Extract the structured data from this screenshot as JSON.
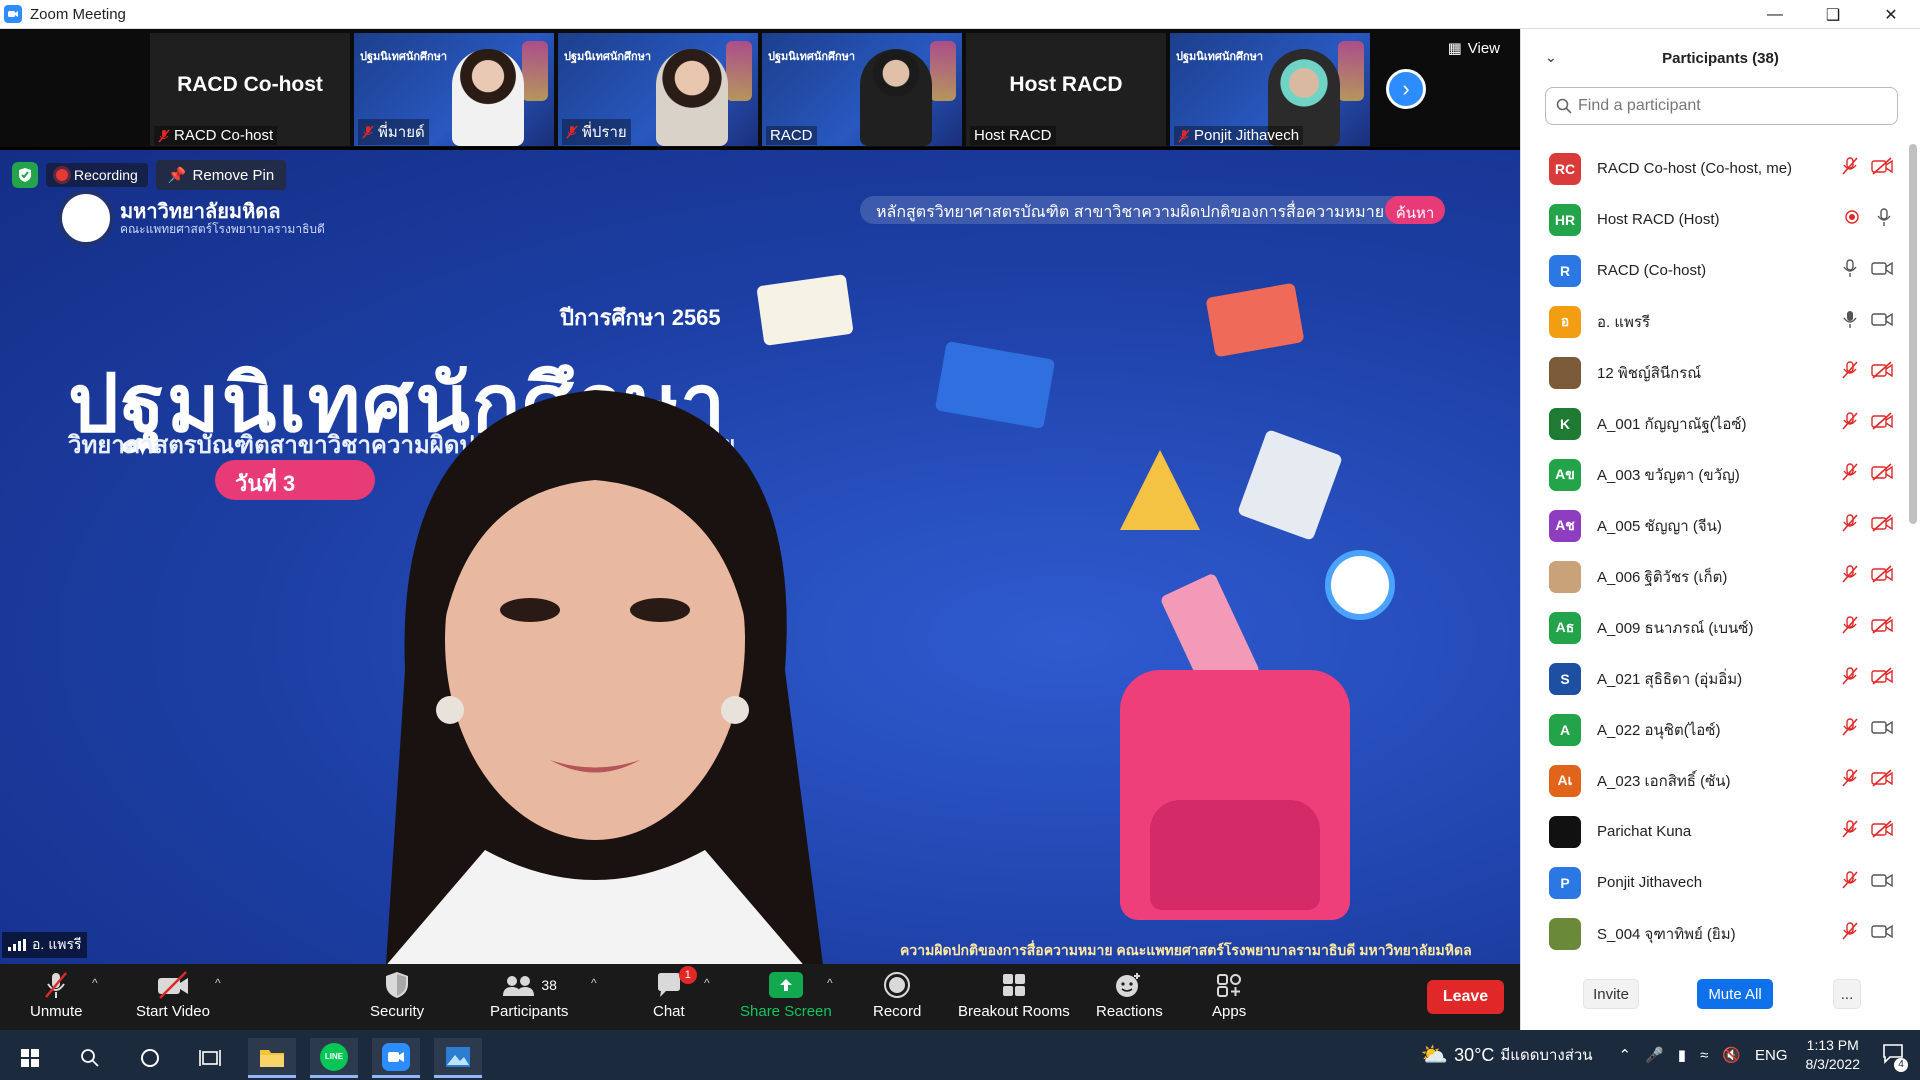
{
  "window": {
    "title": "Zoom Meeting",
    "controls": [
      "minimize",
      "restore",
      "close"
    ]
  },
  "thumbnails": [
    {
      "big_name": "RACD Co-host",
      "label": "RACD Co-host",
      "muted": true,
      "type": "name"
    },
    {
      "big_name": "",
      "label": "พี่มายด์",
      "muted": true,
      "type": "video",
      "banner": "ปฐมนิเทศนักศึกษา"
    },
    {
      "big_name": "",
      "label": "พี่ปราย",
      "muted": true,
      "type": "video",
      "banner": "ปฐมนิเทศนักศึกษา"
    },
    {
      "big_name": "",
      "label": "RACD",
      "muted": false,
      "type": "video",
      "banner": "ปฐมนิเทศนักศึกษา"
    },
    {
      "big_name": "Host RACD",
      "label": "Host RACD",
      "muted": false,
      "type": "name"
    },
    {
      "big_name": "",
      "label": "Ponjit Jithavech",
      "muted": true,
      "type": "video",
      "banner": "ปฐมนิเทศนักศึกษา"
    }
  ],
  "view_button": "View",
  "main_view": {
    "recording_label": "Recording",
    "remove_pin_label": "Remove Pin",
    "speaker_name": "อ. แพรรี",
    "background": {
      "university": "มหาวิทยาลัยมหิดล",
      "university_sub": "คณะแพทยศาสตร์โรงพยาบาลรามาธิบดี",
      "title": "ปฐมนิเทศนักศึกษา",
      "year": "ปีการศึกษา 2565",
      "subtitle": "วิทยาศาสตรบัณฑิตสาขาวิชาความผิดปกติของการสื่อความหมาย",
      "date": "วันที่ 3",
      "top_banner": "หลักสูตรวิทยาศาสตรบัณฑิต สาขาวิชาความผิดปกติของการสื่อความหมาย",
      "top_pill": "ค้นหา",
      "footer": "ความผิดปกติของการสื่อความหมาย คณะแพทยศาสตร์โรงพยาบาลรามาธิบดี มหาวิทยาลัยมหิดล"
    }
  },
  "toolbar": {
    "unmute": "Unmute",
    "start_video": "Start Video",
    "security": "Security",
    "participants": "Participants",
    "participants_count": "38",
    "chat": "Chat",
    "chat_badge": "1",
    "share_screen": "Share Screen",
    "record": "Record",
    "breakout_rooms": "Breakout Rooms",
    "reactions": "Reactions",
    "apps": "Apps",
    "leave": "Leave"
  },
  "panel": {
    "title": "Participants (38)",
    "search_placeholder": "Find a participant",
    "invite": "Invite",
    "mute_all": "Mute All",
    "more": "...",
    "participants": [
      {
        "initials": "RC",
        "color": "#d93b3b",
        "name": "RACD Co-host (Co-host, me)",
        "mic": "muted",
        "video": "off"
      },
      {
        "initials": "HR",
        "color": "#23a34a",
        "name": "Host RACD (Host)",
        "mic": "on",
        "video": "recording"
      },
      {
        "initials": "R",
        "color": "#2b78e4",
        "name": "RACD (Co-host)",
        "mic": "on",
        "video": "on"
      },
      {
        "initials": "อ",
        "color": "#f29d12",
        "name": "อ. แพรรี",
        "mic": "speaking",
        "video": "on"
      },
      {
        "initials": "",
        "color": "#7b5a3a",
        "name": "12 พิชญ์สินีกรณ์",
        "mic": "muted",
        "video": "off"
      },
      {
        "initials": "K",
        "color": "#1f7a33",
        "name": "A_001 กัญญาณัฐ(ไอซ์)",
        "mic": "muted",
        "video": "off"
      },
      {
        "initials": "Aข",
        "color": "#23a34a",
        "name": "A_003 ขวัญตา (ขวัญ)",
        "mic": "muted",
        "video": "off"
      },
      {
        "initials": "Aช",
        "color": "#8e3cc0",
        "name": "A_005 ชัญญา (จีน)",
        "mic": "muted",
        "video": "off"
      },
      {
        "initials": "",
        "color": "#c9a27a",
        "name": "A_006 ฐิติวัชร (เก็ต)",
        "mic": "muted",
        "video": "off"
      },
      {
        "initials": "Aธ",
        "color": "#23a34a",
        "name": "A_009 ธนาภรณ์ (เบนซ์)",
        "mic": "muted",
        "video": "off"
      },
      {
        "initials": "S",
        "color": "#1d4fa3",
        "name": "A_021 สุธิธิดา (อุ่มอิ่ม)",
        "mic": "muted",
        "video": "off"
      },
      {
        "initials": "A",
        "color": "#23a34a",
        "name": "A_022 อนุชิต(ไอซ์)",
        "mic": "muted",
        "video": "on"
      },
      {
        "initials": "Aเ",
        "color": "#e0651a",
        "name": "A_023 เอกสิทธิ์ (ซัน)",
        "mic": "muted",
        "video": "off"
      },
      {
        "initials": "",
        "color": "#111111",
        "name": "Parichat Kuna",
        "mic": "muted",
        "video": "off"
      },
      {
        "initials": "P",
        "color": "#2b78e4",
        "name": "Ponjit Jithavech",
        "mic": "muted",
        "video": "on"
      },
      {
        "initials": "",
        "color": "#6a8a3a",
        "name": "S_004 จุฑาทิพย์ (ยิม)",
        "mic": "muted",
        "video": "on"
      }
    ]
  },
  "taskbar": {
    "weather": "30°C",
    "weather_desc": "มีแดดบางส่วน",
    "language": "ENG",
    "time": "1:13 PM",
    "date": "8/3/2022",
    "notifications": "4"
  }
}
